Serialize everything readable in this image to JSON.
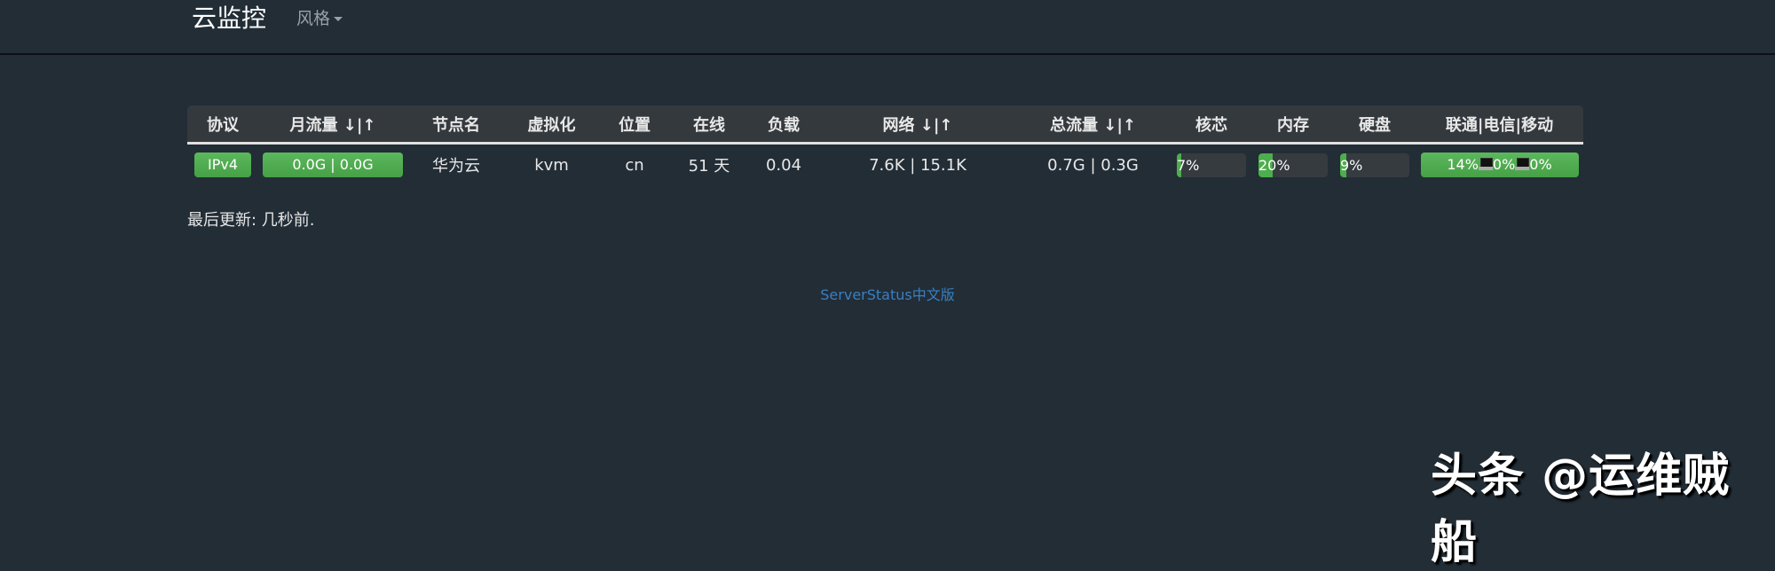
{
  "navbar": {
    "brand": "云监控",
    "style_menu_label": "风格"
  },
  "table": {
    "headers": [
      "协议",
      "月流量 ↓|↑",
      "节点名",
      "虚拟化",
      "位置",
      "在线",
      "负载",
      "网络 ↓|↑",
      "总流量 ↓|↑",
      "核芯",
      "内存",
      "硬盘",
      "联通|电信|移动"
    ],
    "rows": [
      {
        "protocol": "IPv4",
        "monthly_traffic": "0.0G | 0.0G",
        "node_name": "华为云",
        "virtualization": "kvm",
        "location": "cn",
        "uptime": "51 天",
        "load": "0.04",
        "network": "7.6K | 15.1K",
        "total_traffic": "0.7G | 0.3G",
        "cpu": {
          "label": "7%",
          "percent": 7
        },
        "memory": {
          "label": "20%",
          "percent": 20
        },
        "disk": {
          "label": "9%",
          "percent": 9
        },
        "ping": {
          "unicom": "14%",
          "telecom": "0%",
          "mobile": "0%"
        }
      }
    ]
  },
  "last_updated": "最后更新: 几秒前.",
  "footer": {
    "link_text": "ServerStatus中文版"
  },
  "watermark": "头条 @运维贼船",
  "colors": {
    "background": "#222d36",
    "success": "#5cb85c",
    "link": "#3a7fc1"
  }
}
